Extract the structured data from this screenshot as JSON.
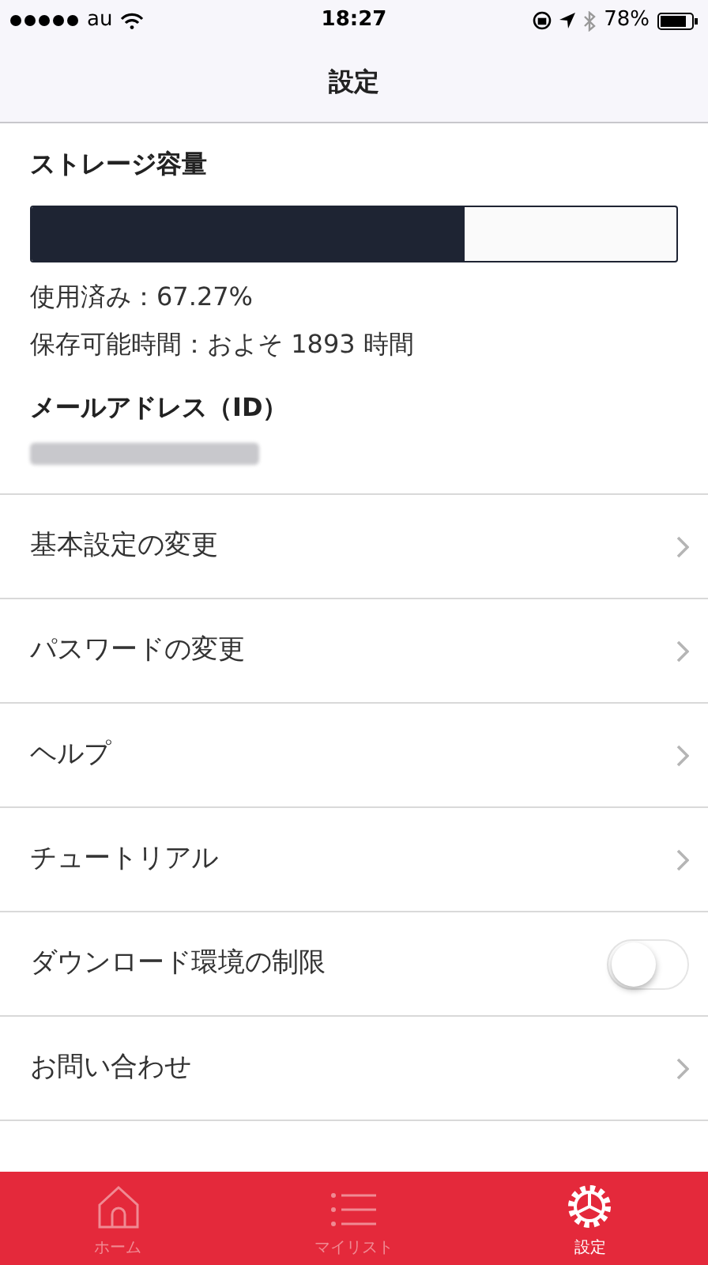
{
  "status_bar": {
    "carrier": "au",
    "time": "18:27",
    "battery": "78%"
  },
  "nav_bar": {
    "title": "設定"
  },
  "storage": {
    "title": "ストレージ容量",
    "level": 0.6727,
    "used": "使用済み：67.27%",
    "remaining": "保存可能時間：およそ 1893 時間"
  },
  "account": {
    "title": "メールアドレス（ID）"
  },
  "menu": [
    {
      "kind": "link",
      "label": "基本設定の変更"
    },
    {
      "kind": "link",
      "label": "パスワードの変更"
    },
    {
      "kind": "link",
      "label": "ヘルプ"
    },
    {
      "kind": "link",
      "label": "チュートリアル"
    },
    {
      "kind": "toggle",
      "label": "ダウンロード環境の制限",
      "on": false
    },
    {
      "kind": "link",
      "label": "お問い合わせ"
    }
  ],
  "tab_bar": [
    {
      "kind": "home",
      "label": "ホーム",
      "selected": false
    },
    {
      "kind": "list",
      "label": "マイリスト",
      "selected": false
    },
    {
      "kind": "settings",
      "label": "設定",
      "selected": true
    }
  ]
}
